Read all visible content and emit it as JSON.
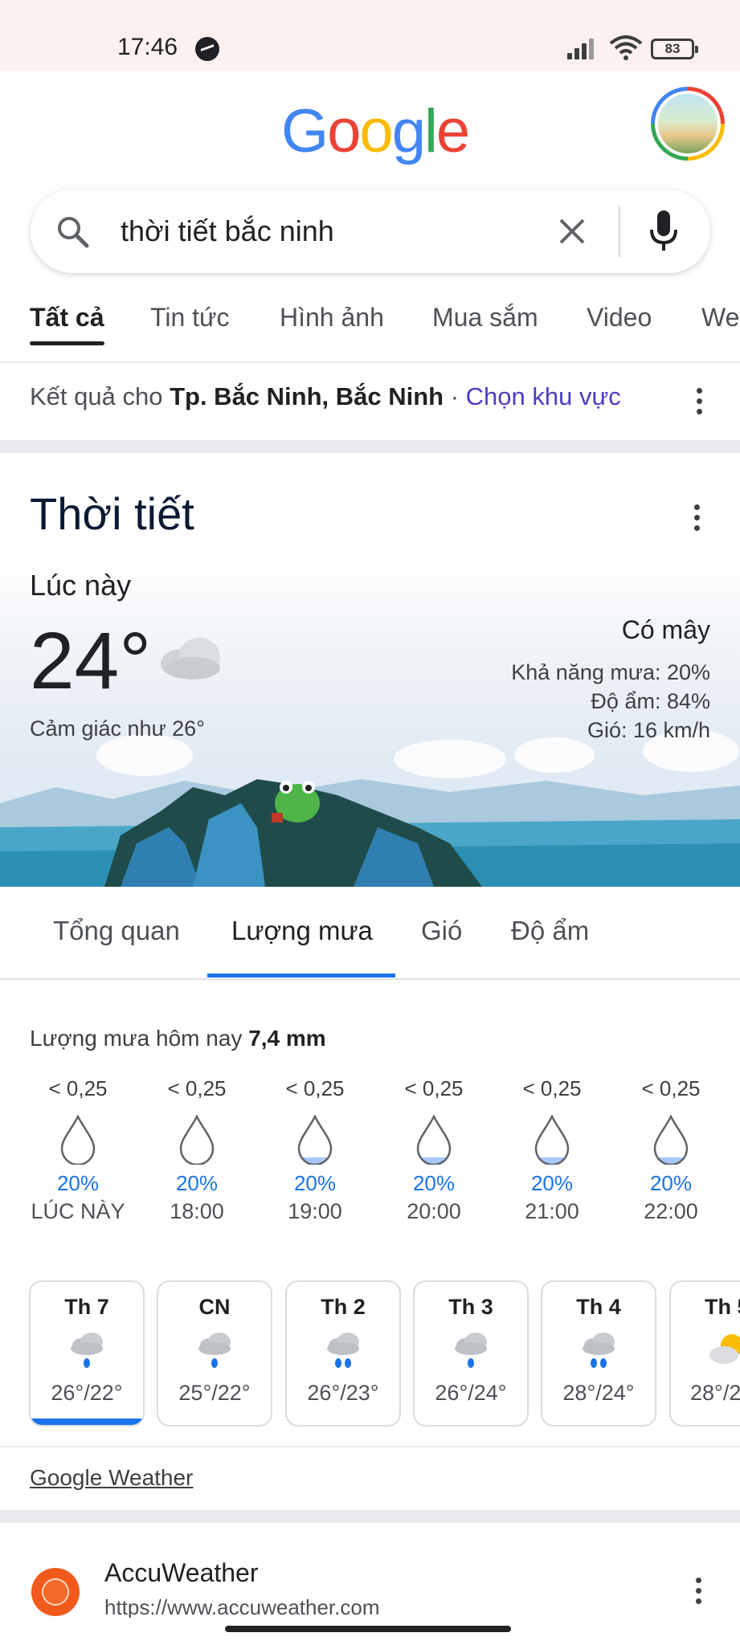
{
  "status_bar": {
    "time": "17:46",
    "battery": "83"
  },
  "header": {
    "logo_letters": [
      "G",
      "o",
      "o",
      "g",
      "l",
      "e"
    ],
    "logo_colors": [
      "#4285f4",
      "#ea4335",
      "#fbbc05",
      "#4285f4",
      "#34a853",
      "#ea4335"
    ]
  },
  "search": {
    "query": "thời tiết bắc ninh"
  },
  "tabs": [
    "Tất cả",
    "Tin tức",
    "Hình ảnh",
    "Mua sắm",
    "Video",
    "We"
  ],
  "results_for": {
    "prefix": "Kết quả cho ",
    "location": "Tp. Bắc Ninh, Bắc Ninh",
    "dot": " · ",
    "link": "Chọn khu vực"
  },
  "weather": {
    "title": "Thời tiết",
    "now_label": "Lúc này",
    "temperature": "24°",
    "feels_like": "Cảm giác như 26°",
    "condition": "Có mây",
    "precip_chance": "Khả năng mưa: 20%",
    "humidity": "Độ ẩm: 84%",
    "wind": "Gió: 16 km/h",
    "tabs": [
      "Tổng quan",
      "Lượng mưa",
      "Gió",
      "Độ ẩm"
    ],
    "rain_today_label": "Lượng mưa hôm nay ",
    "rain_today_value": "7,4 mm",
    "hourly": [
      {
        "amount": "< 0,25",
        "chance": "20%",
        "time": "LÚC NÀY",
        "fill": 0
      },
      {
        "amount": "< 0,25",
        "chance": "20%",
        "time": "18:00",
        "fill": 0
      },
      {
        "amount": "< 0,25",
        "chance": "20%",
        "time": "19:00",
        "fill": 0.15
      },
      {
        "amount": "< 0,25",
        "chance": "20%",
        "time": "20:00",
        "fill": 0.15
      },
      {
        "amount": "< 0,25",
        "chance": "20%",
        "time": "21:00",
        "fill": 0.15
      },
      {
        "amount": "< 0,25",
        "chance": "20%",
        "time": "22:00",
        "fill": 0.15
      }
    ],
    "daily": [
      {
        "day": "Th 7",
        "temps": "26°/22°",
        "icon": "rain-cloud-icon"
      },
      {
        "day": "CN",
        "temps": "25°/22°",
        "icon": "rain-cloud-icon"
      },
      {
        "day": "Th 2",
        "temps": "26°/23°",
        "icon": "heavy-rain-icon"
      },
      {
        "day": "Th 3",
        "temps": "26°/24°",
        "icon": "rain-cloud-icon"
      },
      {
        "day": "Th 4",
        "temps": "28°/24°",
        "icon": "heavy-rain-icon"
      },
      {
        "day": "Th 5",
        "temps": "28°/2",
        "icon": "partly-cloudy-icon"
      }
    ],
    "source_link": "Google Weather"
  },
  "result": {
    "name": "AccuWeather",
    "url": "https://www.accuweather.com"
  },
  "colors": {
    "accent": "#1a73e8",
    "link": "#4b3ec4"
  }
}
